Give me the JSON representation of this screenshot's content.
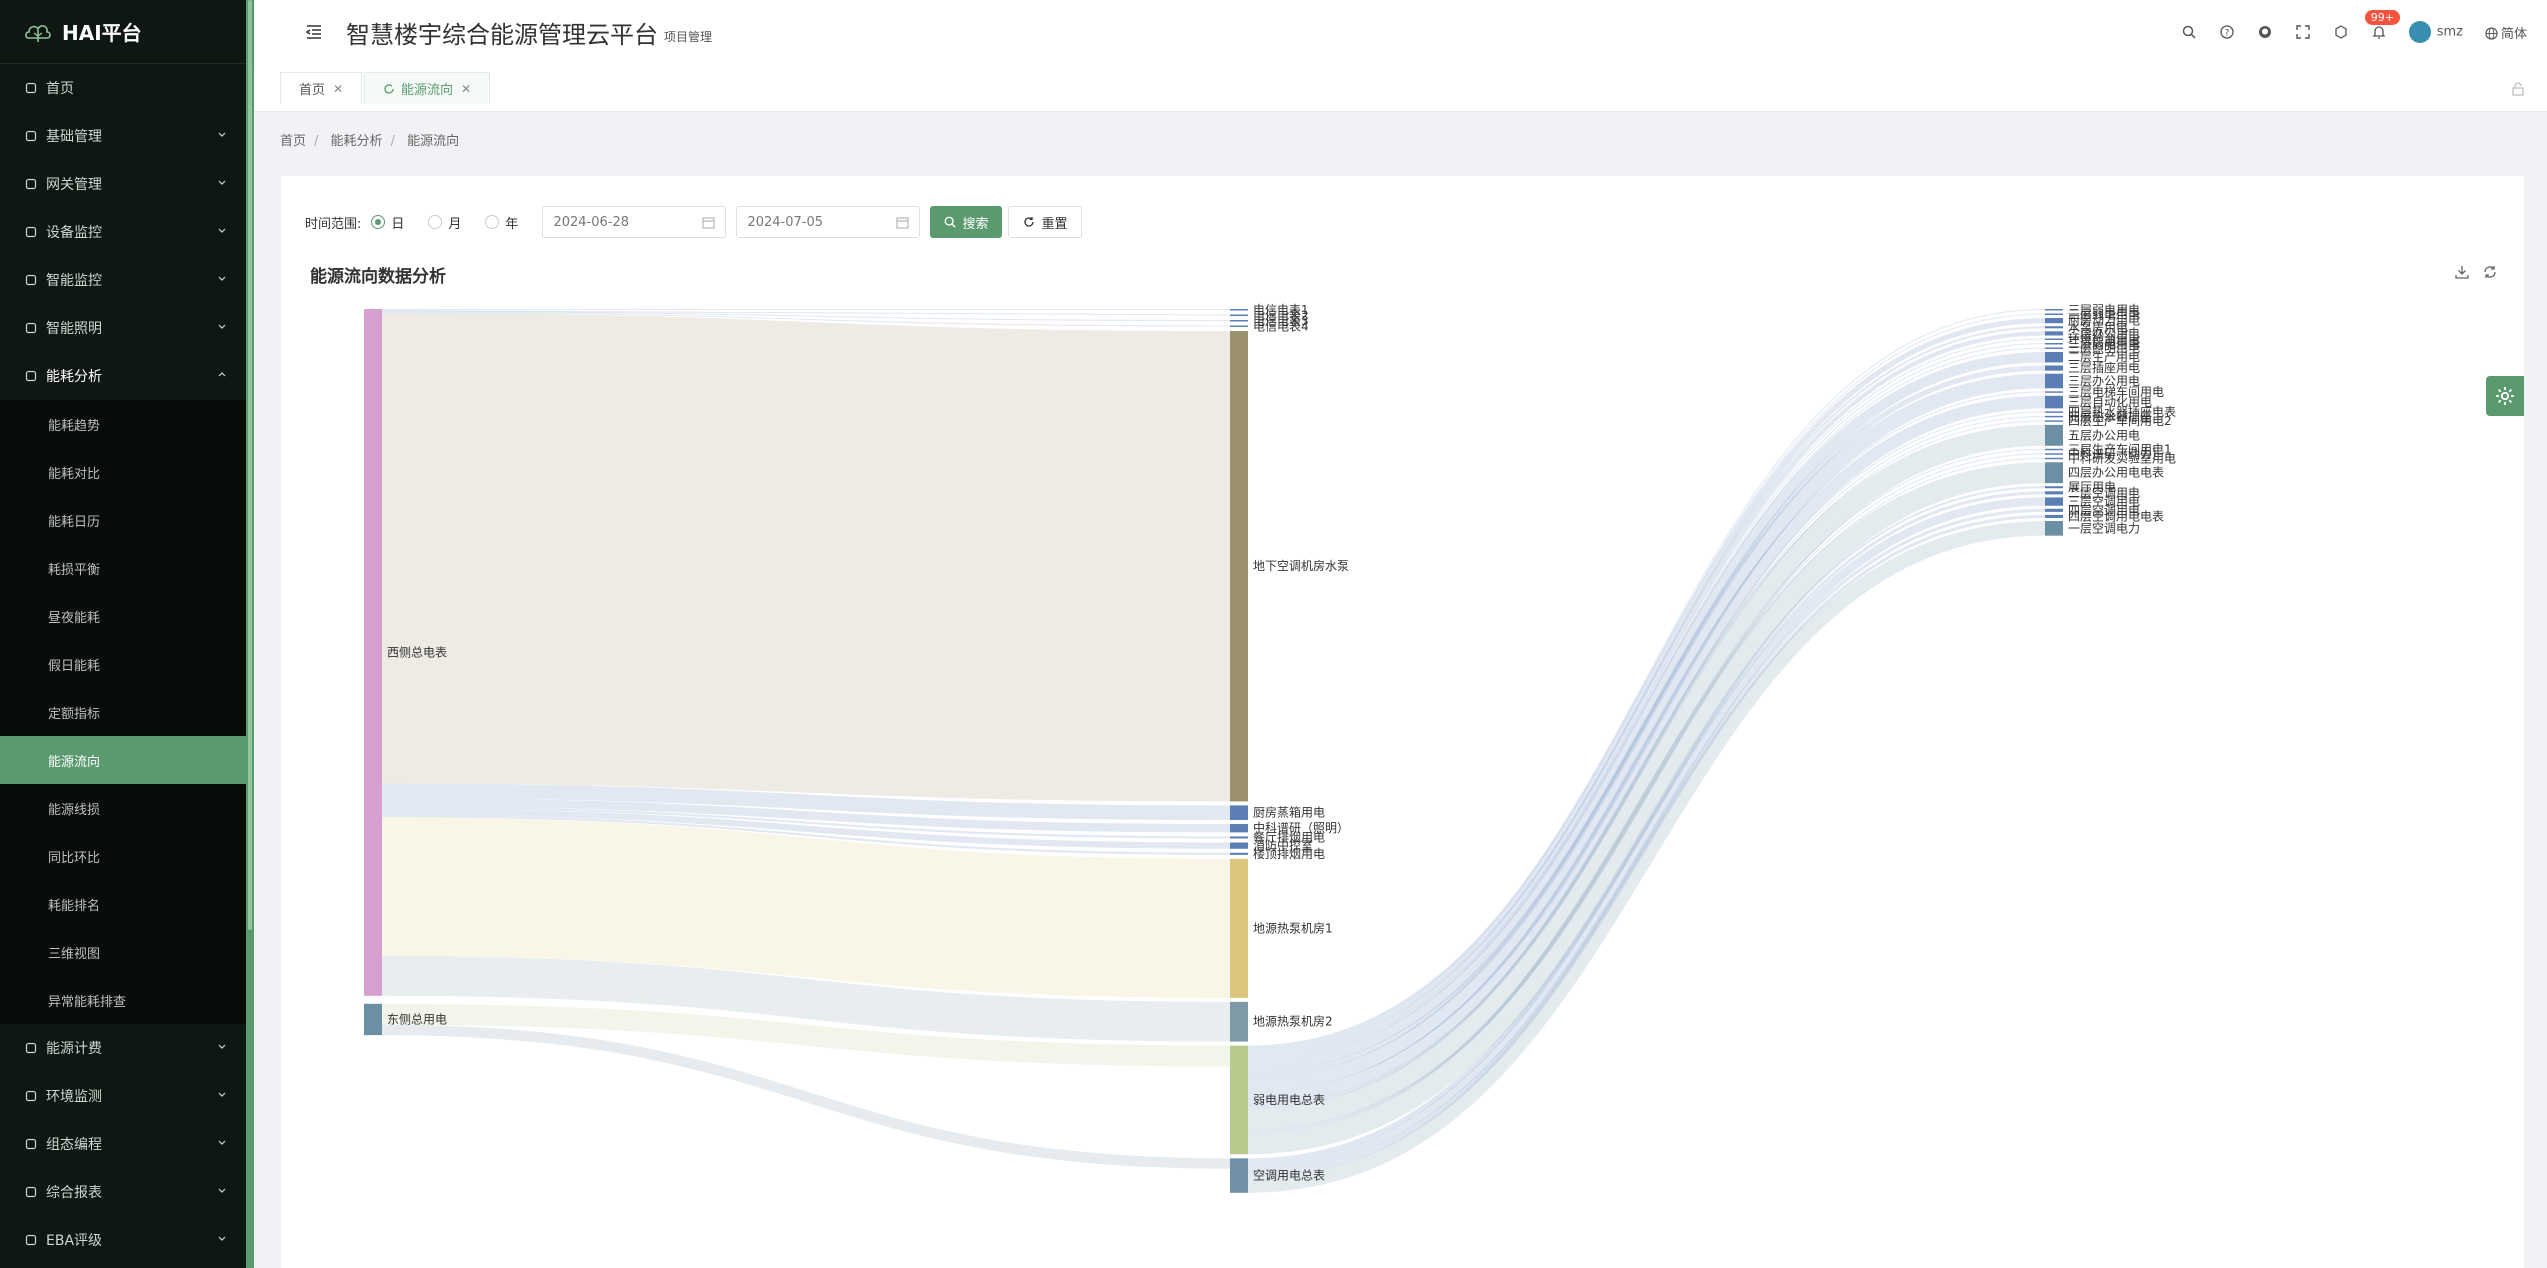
{
  "app": {
    "logo": "HAI平台",
    "title": "智慧楼宇综合能源管理云平台",
    "subtitle": "项目管理"
  },
  "topbar": {
    "notifications": "99+",
    "user": "smz",
    "language": "简体"
  },
  "menu": [
    {
      "label": "首页",
      "icon": "dashboard-icon"
    },
    {
      "label": "基础管理",
      "icon": "database-icon"
    },
    {
      "label": "网关管理",
      "icon": "gateway-icon"
    },
    {
      "label": "设备监控",
      "icon": "device-icon"
    },
    {
      "label": "智能监控",
      "icon": "monitor-icon"
    },
    {
      "label": "智能照明",
      "icon": "bulb-icon"
    },
    {
      "label": "能耗分析",
      "icon": "chart-icon"
    }
  ],
  "submenu": [
    "能耗趋势",
    "能耗对比",
    "能耗日历",
    "耗损平衡",
    "昼夜能耗",
    "假日能耗",
    "定额指标",
    "能源流向",
    "能源线损",
    "同比环比",
    "耗能排名",
    "三维视图",
    "异常能耗排查"
  ],
  "menu_after": [
    {
      "label": "能源计费",
      "icon": "billing-icon"
    },
    {
      "label": "环境监测",
      "icon": "environment-icon"
    },
    {
      "label": "组态编程",
      "icon": "config-icon"
    },
    {
      "label": "综合报表",
      "icon": "report-icon"
    },
    {
      "label": "EBA评级",
      "icon": "rating-icon"
    }
  ],
  "tabs": [
    {
      "label": "首页"
    },
    {
      "label": "能源流向"
    }
  ],
  "breadcrumb": [
    "首页",
    "能耗分析",
    "能源流向"
  ],
  "filter": {
    "label": "时间范围:",
    "options": [
      "日",
      "月",
      "年"
    ],
    "selected": "日",
    "start_date": "2024-06-28",
    "end_date": "2024-07-05",
    "search_label": "搜索",
    "reset_label": "重置"
  },
  "chart_title": "能源流向数据分析",
  "chart_data": {
    "type": "sankey",
    "nodes": [
      {
        "name": "西侧总电表",
        "color": "#d59fd0"
      },
      {
        "name": "东侧总用电",
        "color": "#6b8fa3"
      },
      {
        "name": "电信电表1",
        "color": "#5b7fb5"
      },
      {
        "name": "电信电表2",
        "color": "#5b7fb5"
      },
      {
        "name": "电信电表3",
        "color": "#5b7fb5"
      },
      {
        "name": "电信电表4",
        "color": "#5b7fb5"
      },
      {
        "name": "地下空调机房水泵",
        "color": "#9a916c"
      },
      {
        "name": "厨房蒸箱用电",
        "color": "#5b7fb5"
      },
      {
        "name": "中科谱研（照明）",
        "color": "#5b7fb5"
      },
      {
        "name": "餐厅排烟用电",
        "color": "#5b7fb5"
      },
      {
        "name": "消防中控室",
        "color": "#5b7fb5"
      },
      {
        "name": "楼顶排烟用电",
        "color": "#5b7fb5"
      },
      {
        "name": "地源热泵机房1",
        "color": "#dcc67c"
      },
      {
        "name": "地源热泵机房2",
        "color": "#7e9aa6"
      },
      {
        "name": "弱电用电总表",
        "color": "#b8cb8c"
      },
      {
        "name": "空调用电总表",
        "color": "#7090a8"
      },
      {
        "name": "三层弱电用电",
        "color": "#5b7fb5"
      },
      {
        "name": "三层弱电用电",
        "color": "#5b7fb5"
      },
      {
        "name": "厨房动力用电",
        "color": "#5b7fb5"
      },
      {
        "name": "水泵房用电",
        "color": "#5b7fb5"
      },
      {
        "name": "二层办公用电",
        "color": "#5b7fb5"
      },
      {
        "name": "环境检测用电",
        "color": "#5b7fb5"
      },
      {
        "name": "二层弱电用电",
        "color": "#5b7fb5"
      },
      {
        "name": "三层照明用电",
        "color": "#5b7fb5"
      },
      {
        "name": "二层生产用电",
        "color": "#5b7fb5"
      },
      {
        "name": "三层插座用电",
        "color": "#5b7fb5"
      },
      {
        "name": "三层办公用电",
        "color": "#5b7fb5"
      },
      {
        "name": "三层电梯车间用电",
        "color": "#5b7fb5"
      },
      {
        "name": "三层自动化用电",
        "color": "#5b7fb5"
      },
      {
        "name": "四层热水器插座电表",
        "color": "#5b7fb5"
      },
      {
        "name": "四层热水器插座",
        "color": "#5b7fb5"
      },
      {
        "name": "四层生产车间用电2",
        "color": "#5b7fb5"
      },
      {
        "name": "五层办公用电",
        "color": "#6b8fa3"
      },
      {
        "name": "三层生产车间用电1",
        "color": "#5b7fb5"
      },
      {
        "name": "中科谱研（动力）",
        "color": "#5b7fb5"
      },
      {
        "name": "中科研发实验室用电",
        "color": "#5b7fb5"
      },
      {
        "name": "四层办公用电电表",
        "color": "#6b8fa3"
      },
      {
        "name": "展厅用电",
        "color": "#5b7fb5"
      },
      {
        "name": "二层空调用电",
        "color": "#5b7fb5"
      },
      {
        "name": "三层空调用电",
        "color": "#5b7fb5"
      },
      {
        "name": "四层空调用电",
        "color": "#5b7fb5"
      },
      {
        "name": "四层空调用电电表",
        "color": "#5b7fb5"
      },
      {
        "name": "一层空调电力",
        "color": "#6b8fa3"
      }
    ],
    "links": [
      {
        "source": 0,
        "target": 2,
        "value": 1
      },
      {
        "source": 0,
        "target": 3,
        "value": 1
      },
      {
        "source": 0,
        "target": 4,
        "value": 1
      },
      {
        "source": 0,
        "target": 5,
        "value": 1
      },
      {
        "source": 0,
        "target": 6,
        "value": 450
      },
      {
        "source": 0,
        "target": 7,
        "value": 14
      },
      {
        "source": 0,
        "target": 8,
        "value": 8
      },
      {
        "source": 0,
        "target": 9,
        "value": 2
      },
      {
        "source": 0,
        "target": 10,
        "value": 6
      },
      {
        "source": 0,
        "target": 11,
        "value": 2
      },
      {
        "source": 0,
        "target": 12,
        "value": 133
      },
      {
        "source": 0,
        "target": 13,
        "value": 38
      },
      {
        "source": 1,
        "target": 14,
        "value": 20
      },
      {
        "source": 1,
        "target": 15,
        "value": 10
      },
      {
        "source": 14,
        "target": 16,
        "value": 1
      },
      {
        "source": 14,
        "target": 17,
        "value": 1
      },
      {
        "source": 14,
        "target": 18,
        "value": 5
      },
      {
        "source": 14,
        "target": 19,
        "value": 2
      },
      {
        "source": 14,
        "target": 20,
        "value": 4
      },
      {
        "source": 14,
        "target": 21,
        "value": 1
      },
      {
        "source": 14,
        "target": 22,
        "value": 1
      },
      {
        "source": 14,
        "target": 23,
        "value": 1
      },
      {
        "source": 14,
        "target": 24,
        "value": 10
      },
      {
        "source": 14,
        "target": 25,
        "value": 5
      },
      {
        "source": 14,
        "target": 26,
        "value": 14
      },
      {
        "source": 14,
        "target": 27,
        "value": 1
      },
      {
        "source": 14,
        "target": 28,
        "value": 12
      },
      {
        "source": 14,
        "target": 29,
        "value": 1
      },
      {
        "source": 14,
        "target": 30,
        "value": 1
      },
      {
        "source": 14,
        "target": 31,
        "value": 1
      },
      {
        "source": 14,
        "target": 32,
        "value": 20
      },
      {
        "source": 14,
        "target": 33,
        "value": 1
      },
      {
        "source": 14,
        "target": 34,
        "value": 1
      },
      {
        "source": 14,
        "target": 35,
        "value": 1
      },
      {
        "source": 14,
        "target": 36,
        "value": 20
      },
      {
        "source": 15,
        "target": 37,
        "value": 2
      },
      {
        "source": 15,
        "target": 38,
        "value": 3
      },
      {
        "source": 15,
        "target": 39,
        "value": 8
      },
      {
        "source": 15,
        "target": 40,
        "value": 3
      },
      {
        "source": 15,
        "target": 41,
        "value": 3
      },
      {
        "source": 15,
        "target": 42,
        "value": 14
      }
    ]
  }
}
